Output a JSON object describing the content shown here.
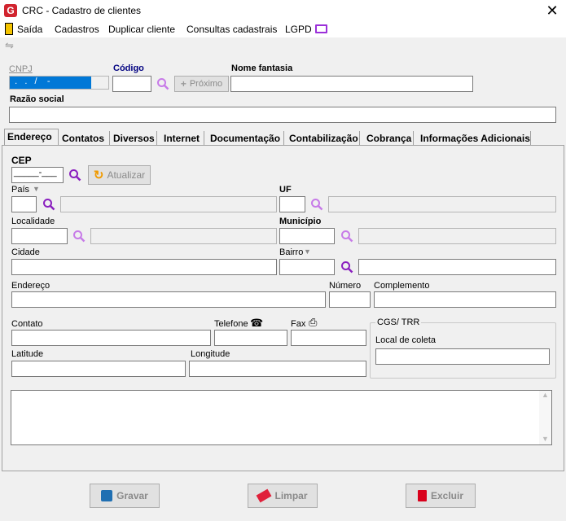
{
  "window": {
    "title": "CRC - Cadastro de clientes",
    "close": "✕",
    "app_icon": "G"
  },
  "menu": [
    "Saída",
    "Cadastros",
    "Duplicar cliente",
    "Consultas cadastrais",
    "LGPD"
  ],
  "header": {
    "cnpj_label": "CNPJ",
    "cnpj_value": "  .   .   /    -  ",
    "codigo_label": "Código",
    "proximo_label": "Próximo",
    "nome_fantasia_label": "Nome fantasia",
    "razao_social_label": "Razão social"
  },
  "tabs": [
    "Endereço",
    "Contatos",
    "Diversos",
    "Internet",
    "Documentação",
    "Contabilização",
    "Cobrança",
    "Informações Adicionais"
  ],
  "endereco": {
    "cep_label": "CEP",
    "cep_mask": "_____-___",
    "atualizar_label": "Atualizar",
    "pais_label": "País",
    "uf_label": "UF",
    "localidade_label": "Localidade",
    "municipio_label": "Município",
    "cidade_label": "Cidade",
    "bairro_label": "Bairro",
    "endereco_label": "Endereço",
    "numero_label": "Número",
    "complemento_label": "Complemento",
    "contato_label": "Contato",
    "telefone_label": "Telefone",
    "fax_label": "Fax",
    "cgs_label": "CGS/ TRR",
    "local_coleta_label": "Local de coleta",
    "latitude_label": "Latitude",
    "longitude_label": "Longitude"
  },
  "footer": {
    "gravar": "Gravar",
    "limpar": "Limpar",
    "excluir": "Excluir"
  },
  "colors": {
    "accent": "#9b30d9",
    "selection": "#0078d7",
    "app_icon": "#d1242f",
    "delete_icon": "#d9001b",
    "save_icon": "#1f6fb2"
  }
}
